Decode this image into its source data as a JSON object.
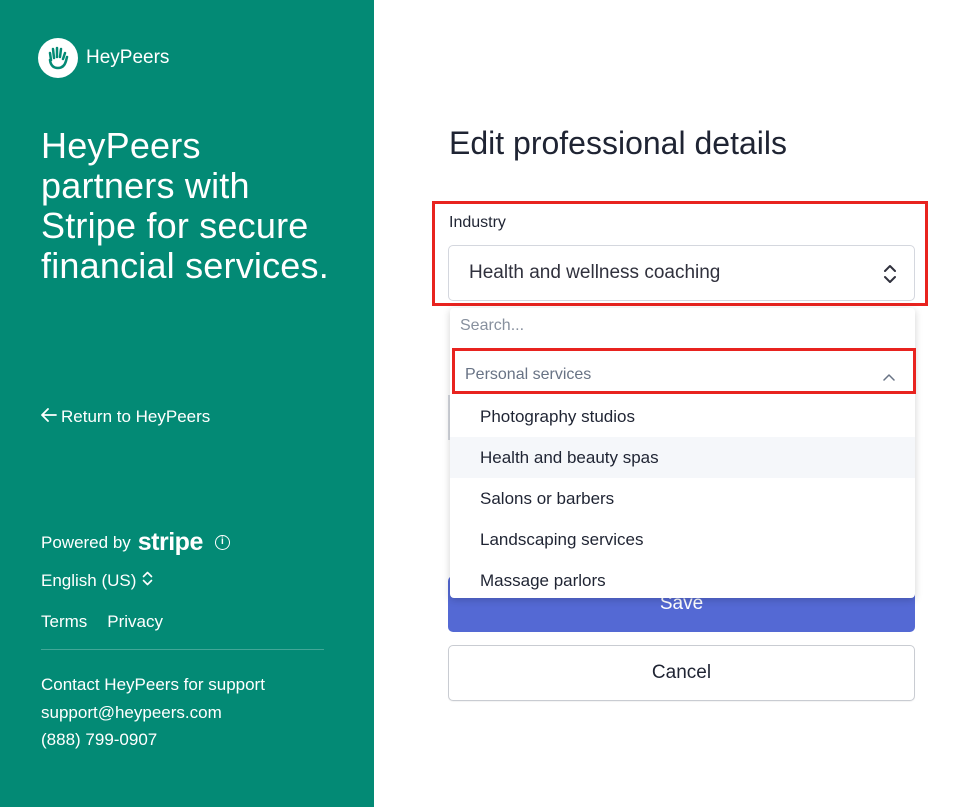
{
  "brand": {
    "name": "HeyPeers",
    "logo_icon": "waving-hand-icon"
  },
  "left_panel": {
    "headline": "HeyPeers partners with Stripe for secure financial services.",
    "return_link": "Return to HeyPeers",
    "powered_by": "Powered by",
    "stripe_wordmark": "stripe",
    "language": "English (US)",
    "terms": "Terms",
    "privacy": "Privacy",
    "support_heading": "Contact HeyPeers for support",
    "support_email": "support@heypeers.com",
    "support_phone": "(888) 799-0907"
  },
  "form": {
    "title": "Edit professional details",
    "industry_label": "Industry",
    "industry_value": "Health and wellness coaching",
    "save_label": "Save",
    "cancel_label": "Cancel"
  },
  "dropdown": {
    "search_placeholder": "Search...",
    "group_label": "Personal services",
    "options": [
      "Photography studios",
      "Health and beauty spas",
      "Salons or barbers",
      "Landscaping services",
      "Massage parlors"
    ],
    "hovered_option": "Health and beauty spas"
  },
  "colors": {
    "left_panel_bg": "#038a75",
    "primary_button": "#5469d4",
    "highlight_box": "#e8231f"
  }
}
